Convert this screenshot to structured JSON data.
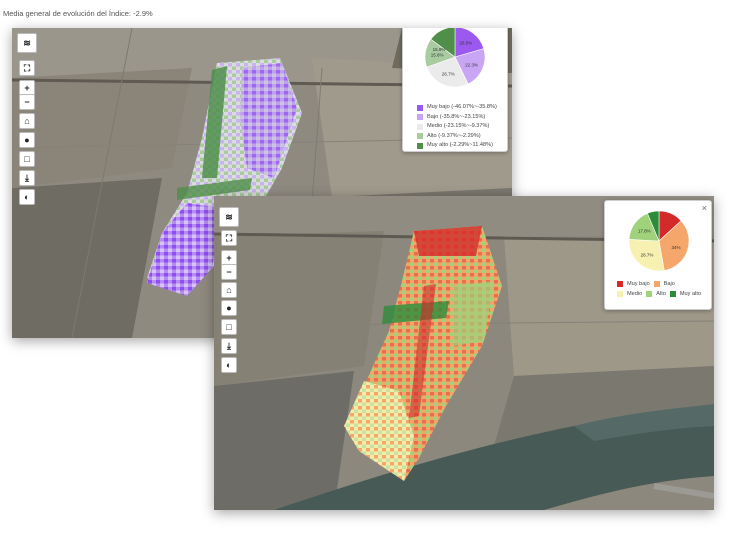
{
  "caption": "Media general de evolución del Índice: -2.9%",
  "controls": {
    "layers_icon": "layers-icon",
    "fullscreen": "⛶",
    "zoom_in": "+",
    "zoom_out": "−",
    "home": "⌂",
    "marker": "●",
    "draw": "□",
    "download": "⤓",
    "chart": "◐"
  },
  "legend1": {
    "close": "×",
    "slices": [
      {
        "label": "Muy bajo (-46.07%~-35.8%)",
        "value": 20.5,
        "text": "20.5%",
        "color": "#9b59f0"
      },
      {
        "label": "Bajo (-35.8%~-23.15%)",
        "value": 22.3,
        "text": "22.3%",
        "color": "#c9a6f5"
      },
      {
        "label": "Medio (-23.15%~-9.37%)",
        "value": 26.7,
        "text": "26.7%",
        "color": "#ebebeb"
      },
      {
        "label": "Alto (-9.37%~-2.29%)",
        "value": 15.6,
        "text": "15.6%",
        "color": "#a8cba0"
      },
      {
        "label": "Muy alto (-2.29%~11.48%)",
        "value": 14.9,
        "text": "",
        "color": "#4f8f4a"
      }
    ],
    "label_15_9": "15.9%"
  },
  "legend2": {
    "close": "×",
    "slices": [
      {
        "label": "Muy bajo",
        "value": 13.2,
        "text": "",
        "color": "#d42a2a"
      },
      {
        "label": "Bajo",
        "value": 34.0,
        "text": "34%",
        "color": "#f5a66a"
      },
      {
        "label": "Medio",
        "value": 28.7,
        "text": "28.7%",
        "color": "#f6f1b0"
      },
      {
        "label": "Alto",
        "value": 17.8,
        "text": "17.8%",
        "color": "#9fd27a"
      },
      {
        "label": "Muy alto",
        "value": 6.3,
        "text": "",
        "color": "#2e8b3a"
      }
    ]
  }
}
